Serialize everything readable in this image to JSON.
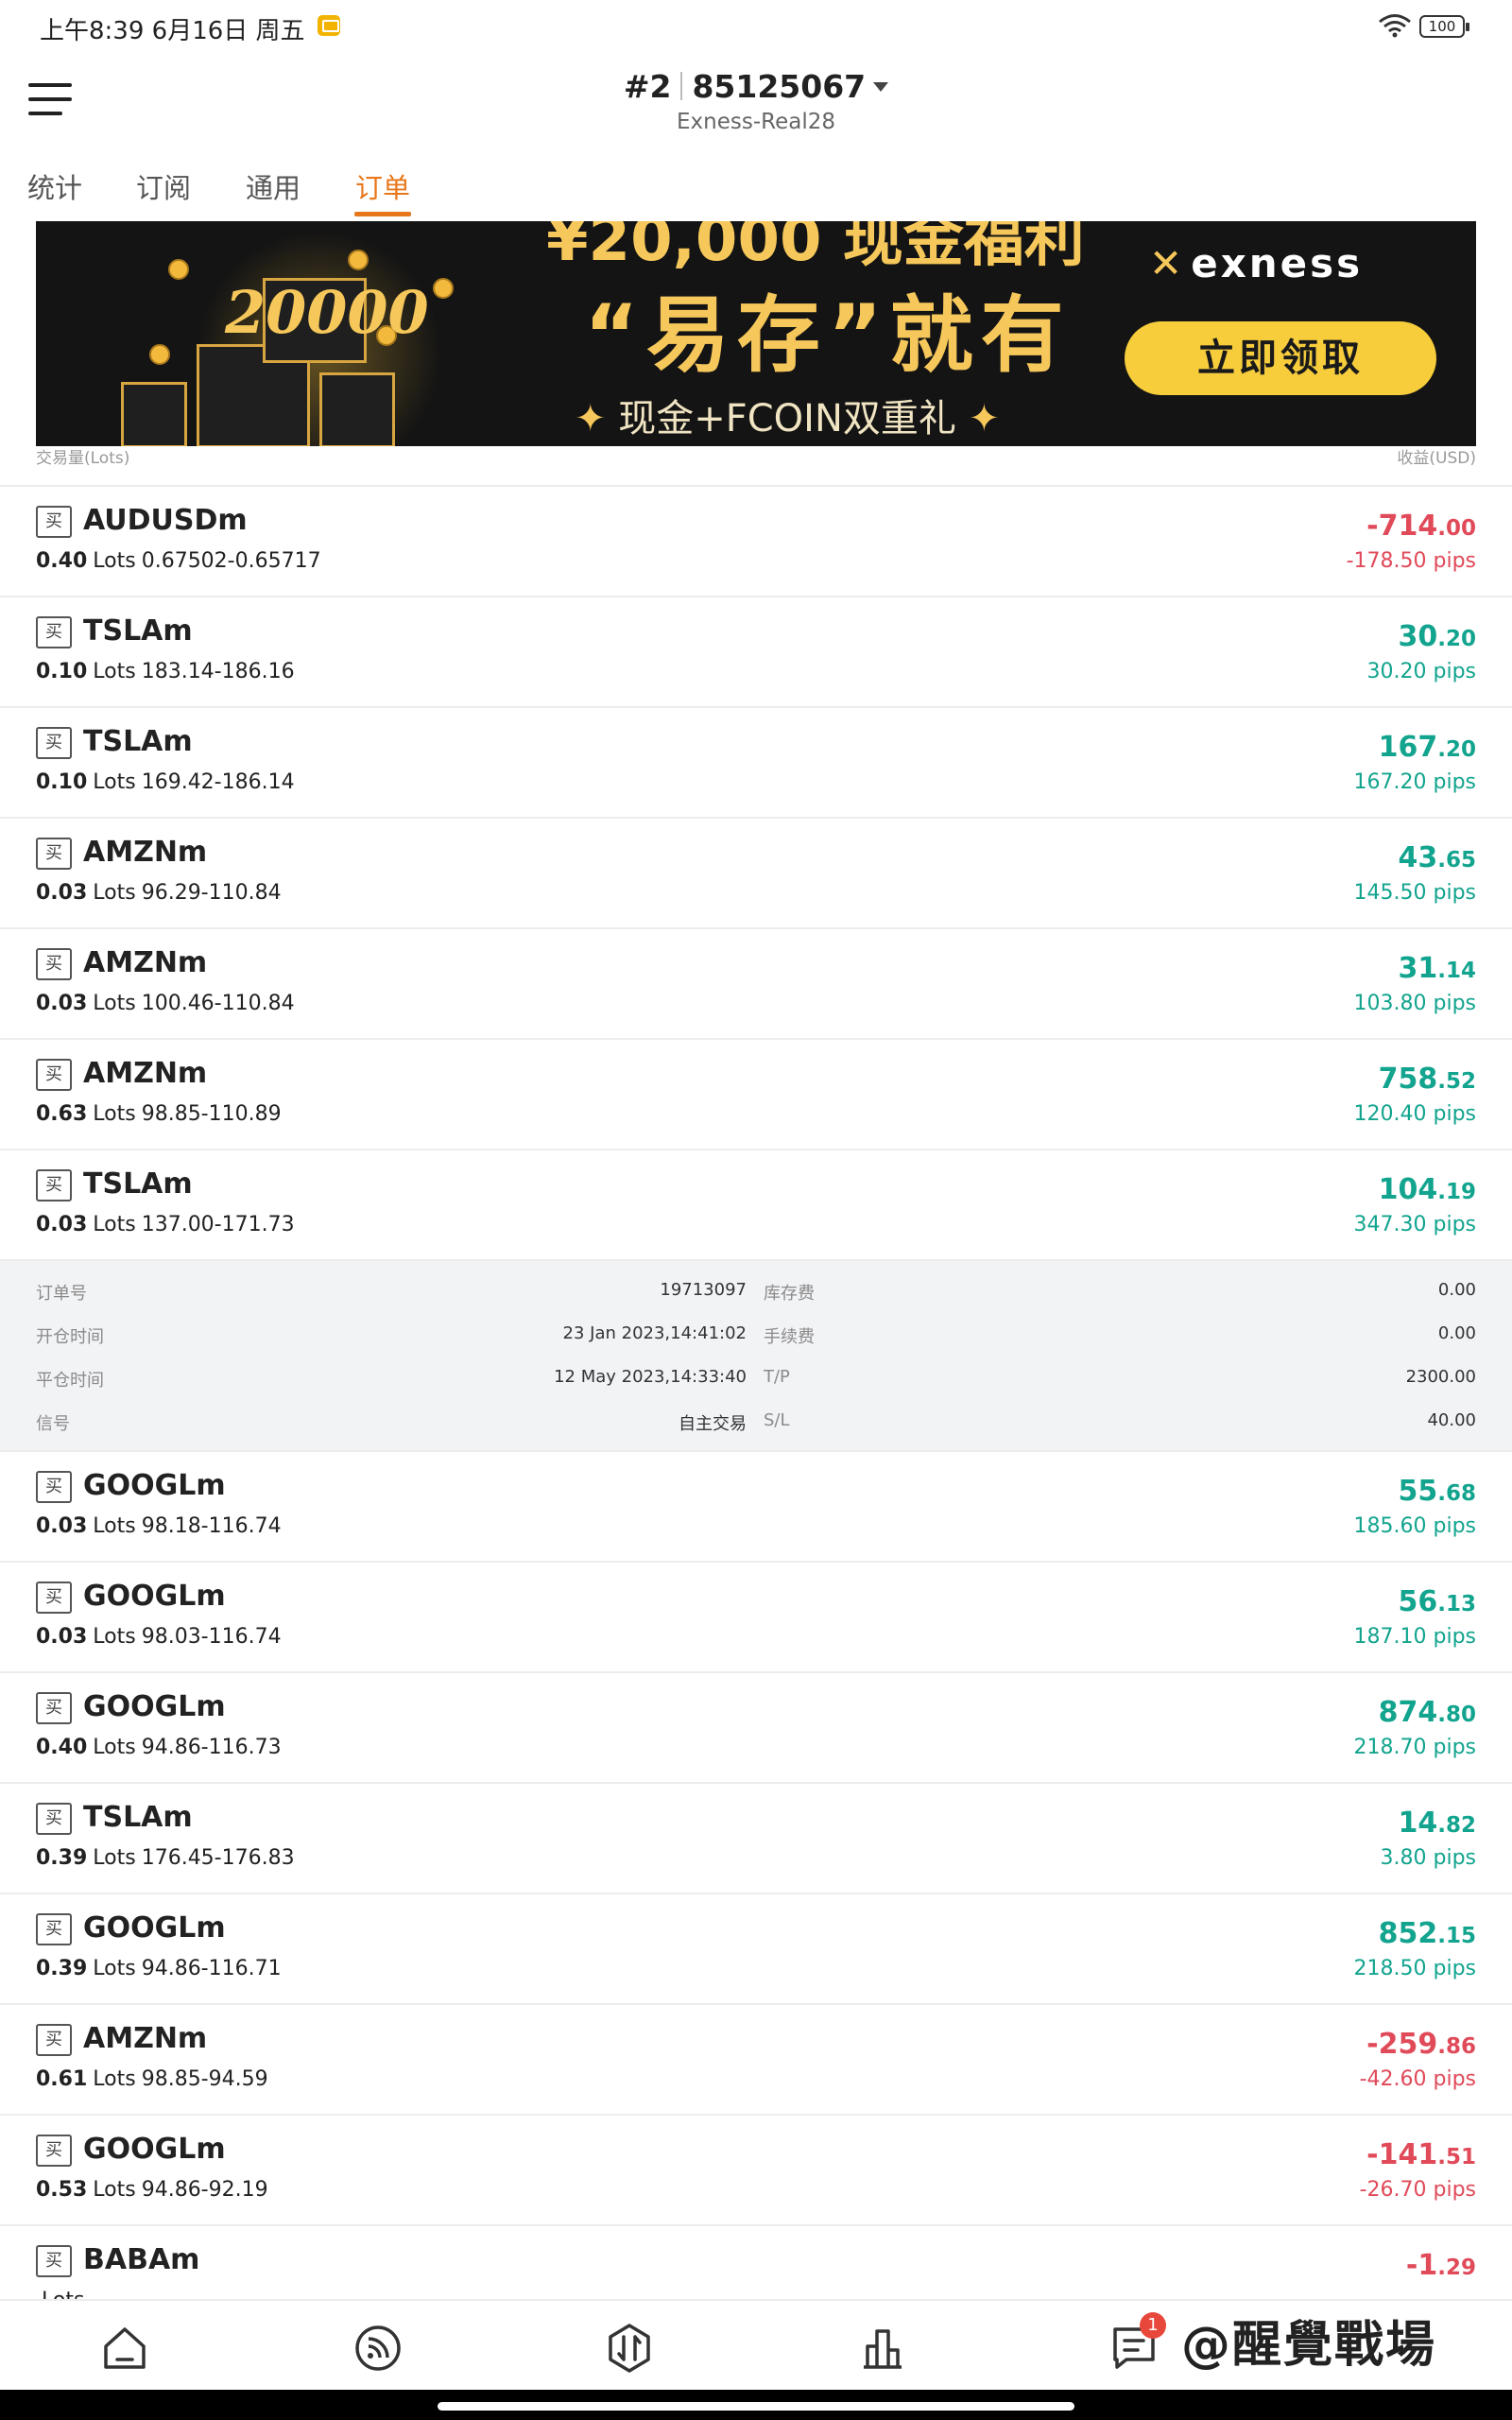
{
  "status_bar": {
    "time": "上午8:39 6月16日 周五",
    "battery": "100"
  },
  "header": {
    "account_prefix": "#2",
    "account_number": "85125067",
    "server": "Exness-Real28"
  },
  "tabs": [
    {
      "label": "统计",
      "active": false
    },
    {
      "label": "订阅",
      "active": false
    },
    {
      "label": "通用",
      "active": false
    },
    {
      "label": "订单",
      "active": true
    }
  ],
  "banner": {
    "top_line": "¥20,000 现金福利",
    "headline": "“易存”就有",
    "subline": "现金+FCOIN双重礼",
    "gift_number": "20000",
    "brand": "exness",
    "button_label": "立即领取"
  },
  "columns": {
    "left": "交易量(Lots)",
    "right": "收益(USD)"
  },
  "lots_unit": "Lots",
  "orders_top": [
    {
      "side": "买",
      "symbol": "AUDUSDm",
      "lots": "0.40",
      "prices": "0.67502-0.65717",
      "profit_int": "-714",
      "profit_dec": ".00",
      "pips": "-178.50 pips",
      "positive": false
    },
    {
      "side": "买",
      "symbol": "TSLAm",
      "lots": "0.10",
      "prices": "183.14-186.16",
      "profit_int": "30",
      "profit_dec": ".20",
      "pips": "30.20 pips",
      "positive": true
    },
    {
      "side": "买",
      "symbol": "TSLAm",
      "lots": "0.10",
      "prices": "169.42-186.14",
      "profit_int": "167",
      "profit_dec": ".20",
      "pips": "167.20 pips",
      "positive": true
    },
    {
      "side": "买",
      "symbol": "AMZNm",
      "lots": "0.03",
      "prices": "96.29-110.84",
      "profit_int": "43",
      "profit_dec": ".65",
      "pips": "145.50 pips",
      "positive": true
    },
    {
      "side": "买",
      "symbol": "AMZNm",
      "lots": "0.03",
      "prices": "100.46-110.84",
      "profit_int": "31",
      "profit_dec": ".14",
      "pips": "103.80 pips",
      "positive": true
    },
    {
      "side": "买",
      "symbol": "AMZNm",
      "lots": "0.63",
      "prices": "98.85-110.89",
      "profit_int": "758",
      "profit_dec": ".52",
      "pips": "120.40 pips",
      "positive": true
    },
    {
      "side": "买",
      "symbol": "TSLAm",
      "lots": "0.03",
      "prices": "137.00-171.73",
      "profit_int": "104",
      "profit_dec": ".19",
      "pips": "347.30 pips",
      "positive": true
    }
  ],
  "detail": {
    "order_no_label": "订单号",
    "order_no": "19713097",
    "swap_label": "库存费",
    "swap": "0.00",
    "open_time_label": "开仓时间",
    "open_time": "23 Jan 2023,14:41:02",
    "commission_label": "手续费",
    "commission": "0.00",
    "close_time_label": "平仓时间",
    "close_time": "12 May 2023,14:33:40",
    "tp_label": "T/P",
    "tp": "2300.00",
    "signal_label": "信号",
    "signal": "自主交易",
    "sl_label": "S/L",
    "sl": "40.00"
  },
  "orders_bottom": [
    {
      "side": "买",
      "symbol": "GOOGLm",
      "lots": "0.03",
      "prices": "98.18-116.74",
      "profit_int": "55",
      "profit_dec": ".68",
      "pips": "185.60 pips",
      "positive": true
    },
    {
      "side": "买",
      "symbol": "GOOGLm",
      "lots": "0.03",
      "prices": "98.03-116.74",
      "profit_int": "56",
      "profit_dec": ".13",
      "pips": "187.10 pips",
      "positive": true
    },
    {
      "side": "买",
      "symbol": "GOOGLm",
      "lots": "0.40",
      "prices": "94.86-116.73",
      "profit_int": "874",
      "profit_dec": ".80",
      "pips": "218.70 pips",
      "positive": true
    },
    {
      "side": "买",
      "symbol": "TSLAm",
      "lots": "0.39",
      "prices": "176.45-176.83",
      "profit_int": "14",
      "profit_dec": ".82",
      "pips": "3.80 pips",
      "positive": true
    },
    {
      "side": "买",
      "symbol": "GOOGLm",
      "lots": "0.39",
      "prices": "94.86-116.71",
      "profit_int": "852",
      "profit_dec": ".15",
      "pips": "218.50 pips",
      "positive": true
    },
    {
      "side": "买",
      "symbol": "AMZNm",
      "lots": "0.61",
      "prices": "98.85-94.59",
      "profit_int": "-259",
      "profit_dec": ".86",
      "pips": "-42.60 pips",
      "positive": false
    },
    {
      "side": "买",
      "symbol": "GOOGLm",
      "lots": "0.53",
      "prices": "94.86-92.19",
      "profit_int": "-141",
      "profit_dec": ".51",
      "pips": "-26.70 pips",
      "positive": false
    },
    {
      "side": "买",
      "symbol": "BABAm",
      "lots": "",
      "prices": "",
      "profit_int": "-1",
      "profit_dec": ".29",
      "pips": "",
      "positive": false
    }
  ],
  "bottom_nav": {
    "items": [
      "home-icon",
      "feed-icon",
      "trade-icon",
      "chart-icon",
      "messages-icon"
    ],
    "message_badge": "1"
  },
  "watermark": "@醒覺戰場",
  "colors": {
    "accent": "#e8771b",
    "profit": "#12a48e",
    "loss": "#e04a59",
    "banner_gold": "#f6c75a"
  }
}
